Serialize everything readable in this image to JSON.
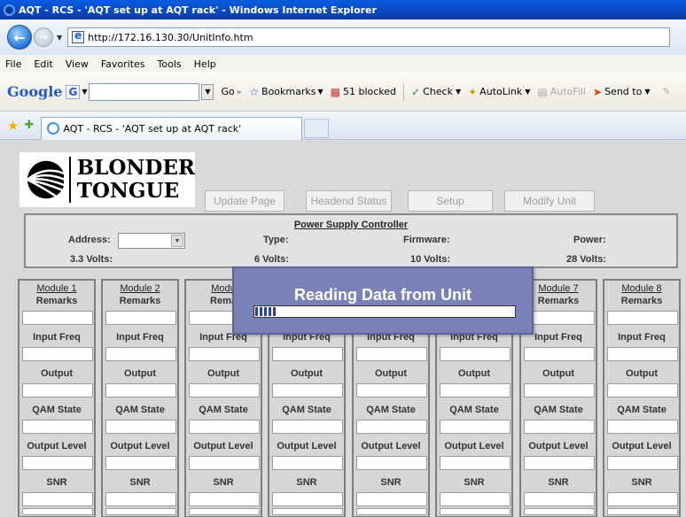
{
  "browser": {
    "window_title": "AQT - RCS - 'AQT set up at AQT rack' - Windows Internet Explorer",
    "address": "http://172.16.130.30/UnitInfo.htm",
    "menu": [
      "File",
      "Edit",
      "View",
      "Favorites",
      "Tools",
      "Help"
    ],
    "google_toolbar": {
      "logo": "Google",
      "g_button": "G",
      "go": "Go",
      "bookmarks": "Bookmarks",
      "blocked": "51 blocked",
      "check": "Check",
      "autolink": "AutoLink",
      "autofill": "AutoFill",
      "sendto": "Send to"
    },
    "tab_title": "AQT - RCS - 'AQT set up at AQT rack'"
  },
  "page": {
    "logo_line1": "BLONDER",
    "logo_line2": "TONGUE",
    "buttons": {
      "update": "Update Page",
      "headend": "Headend Status",
      "setup": "Setup",
      "modify": "Modify Unit"
    },
    "psc": {
      "title": "Power Supply Controller",
      "address": "Address:",
      "type": "Type:",
      "firmware": "Firmware:",
      "power": "Power:",
      "v33": "3.3 Volts:",
      "v6": "6 Volts:",
      "v10": "10 Volts:",
      "v28": "28 Volts:"
    },
    "module_fields": {
      "remarks": "Remarks",
      "input_freq": "Input Freq",
      "output": "Output",
      "qam_state": "QAM State",
      "output_level": "Output Level",
      "snr": "SNR"
    },
    "modules": [
      {
        "title": "Module 1"
      },
      {
        "title": "Module 2"
      },
      {
        "title": "Modu"
      },
      {
        "title": ""
      },
      {
        "title": ""
      },
      {
        "title": ""
      },
      {
        "title": "Module 7"
      },
      {
        "title": "Module 8"
      }
    ],
    "module3_remarks": "Rema",
    "dialog": {
      "message": "Reading Data from Unit",
      "progress_fraction": 0.08
    }
  }
}
